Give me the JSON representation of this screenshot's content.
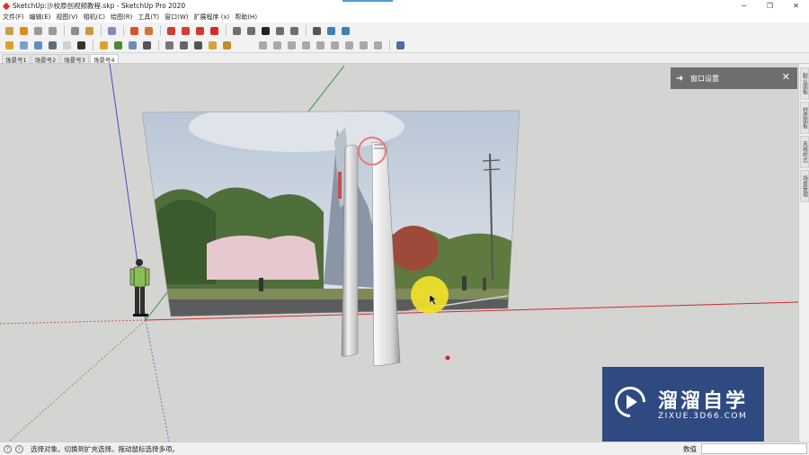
{
  "window": {
    "title": "SketchUp:沙校原创视频教程.skp - SketchUp Pro 2020",
    "minimize": "─",
    "maximize": "❐",
    "close": "✕"
  },
  "menu": [
    "文件(F)",
    "编辑(E)",
    "视图(V)",
    "相机(C)",
    "绘图(R)",
    "工具(T)",
    "窗口(W)",
    "扩展程序 (x)",
    "帮助(H)"
  ],
  "toolbar": {
    "row1": [
      {
        "name": "orbit-icon",
        "color": "#c8a24a"
      },
      {
        "name": "play-icon",
        "color": "#e08a1e"
      },
      {
        "name": "stop-icon",
        "color": "#9a9a9a"
      },
      {
        "name": "previous-icon",
        "color": "#9a9a9a"
      },
      {
        "name": "sep"
      },
      {
        "name": "walk-icon",
        "color": "#8c8c8c"
      },
      {
        "name": "position-camera-icon",
        "color": "#c79a3a"
      },
      {
        "name": "sep"
      },
      {
        "name": "lock-icon",
        "color": "#7a8fb3"
      },
      {
        "name": "sep"
      },
      {
        "name": "explode-icon",
        "color": "#d9532b"
      },
      {
        "name": "grid-icon",
        "color": "#d0763a"
      },
      {
        "name": "sep"
      },
      {
        "name": "cloud-icon",
        "color": "#cf3d32"
      },
      {
        "name": "gear-red-icon",
        "color": "#d2402f"
      },
      {
        "name": "folder-red-icon",
        "color": "#d33b2e"
      },
      {
        "name": "record-icon",
        "color": "#d02d26"
      },
      {
        "name": "sep"
      },
      {
        "name": "page-icon",
        "color": "#6f6f6f"
      },
      {
        "name": "new-file-icon",
        "color": "#6f6f6f"
      },
      {
        "name": "black-square-icon",
        "color": "#222222"
      },
      {
        "name": "dash-icon",
        "color": "#6f6f6f"
      },
      {
        "name": "folder-outline-icon",
        "color": "#6f6f6f"
      },
      {
        "name": "sep"
      },
      {
        "name": "resize-icon",
        "color": "#555555"
      },
      {
        "name": "component-icon",
        "color": "#3f7fb8"
      },
      {
        "name": "settings-blue-icon",
        "color": "#3f7fb8"
      }
    ],
    "row2": [
      {
        "name": "shield-icon",
        "color": "#d9a32b"
      },
      {
        "name": "sphere-icon",
        "color": "#7aa2c9"
      },
      {
        "name": "dish-icon",
        "color": "#5d8fc4"
      },
      {
        "name": "chain-icon",
        "color": "#5f6f80"
      },
      {
        "name": "box-icon",
        "color": "#d0d0d0"
      },
      {
        "name": "glasses-icon",
        "color": "#333333"
      },
      {
        "name": "sep"
      },
      {
        "name": "shield-gold-icon",
        "color": "#d9a32b"
      },
      {
        "name": "tree-icon",
        "color": "#4b8a2f"
      },
      {
        "name": "photo-icon",
        "color": "#6a8fb5"
      },
      {
        "name": "speaker-icon",
        "color": "#555555"
      },
      {
        "name": "sep"
      },
      {
        "name": "ruler-icon",
        "color": "#777777"
      },
      {
        "name": "chat-icon",
        "color": "#666666"
      },
      {
        "name": "tag-icon",
        "color": "#555555"
      },
      {
        "name": "cup-icon",
        "color": "#d8a13a"
      },
      {
        "name": "image-icon",
        "color": "#c28d2a"
      },
      {
        "name": "gap"
      },
      {
        "name": "view-iso-icon",
        "color": "#a9a9a9"
      },
      {
        "name": "view-top-icon",
        "color": "#a9a9a9"
      },
      {
        "name": "view-front-icon",
        "color": "#a9a9a9"
      },
      {
        "name": "view-right-icon",
        "color": "#a9a9a9"
      },
      {
        "name": "view-back-icon",
        "color": "#a9a9a9"
      },
      {
        "name": "view-left-icon",
        "color": "#a9a9a9"
      },
      {
        "name": "view-bottom-icon",
        "color": "#a9a9a9"
      },
      {
        "name": "view-camera-icon",
        "color": "#a9a9a9"
      },
      {
        "name": "view-perspective-icon",
        "color": "#a9a9a9"
      },
      {
        "name": "sep"
      },
      {
        "name": "globe-icon",
        "color": "#4d6f9c"
      }
    ]
  },
  "scenes": {
    "tabs": [
      "场景号1",
      "场景号2",
      "场景号3",
      "场景号4"
    ],
    "active_index": 3
  },
  "tray": {
    "header_title": "窗口设置",
    "tabs": [
      "默认面板",
      "材质面板",
      "风格样式",
      "场景管理"
    ]
  },
  "watermark": {
    "title": "溜溜自学",
    "url": "ZIXUE.3D66.COM"
  },
  "status": {
    "message": "选择对象。切换到扩充选择。拖动鼠标选择多项。",
    "measurement_label": "数值",
    "measurement_value": ""
  }
}
